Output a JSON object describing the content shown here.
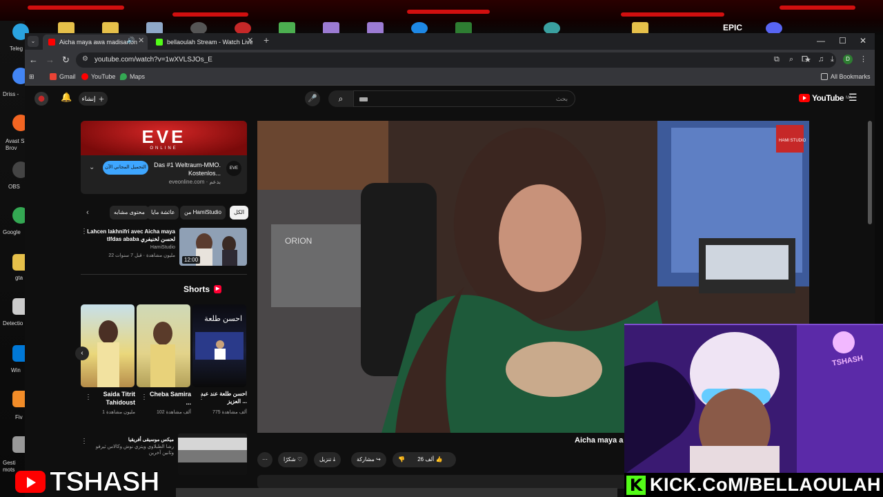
{
  "desktop": {
    "left_icons": [
      {
        "label": "Teleg",
        "color": "#2aa3e0"
      },
      {
        "label": "Driss -",
        "color": "#4285f4"
      },
      {
        "label": "Avast S Brov",
        "color": "#f26522"
      },
      {
        "label": "OBS",
        "color": "#444444"
      },
      {
        "label": "Google",
        "color": "#34a853"
      },
      {
        "label": "gta",
        "color": "#e6c04a"
      },
      {
        "label": "Detectio",
        "color": "#cccccc"
      },
      {
        "label": "Win",
        "color": "#0078d7"
      },
      {
        "label": "Fiv",
        "color": "#f28c28"
      },
      {
        "label": "Gesti mots",
        "color": "#999999"
      }
    ],
    "epic_label": "EPIC"
  },
  "browser": {
    "tabs": [
      {
        "title": "Aicha maya awa madisarton",
        "active": true
      },
      {
        "title": "bellaoulah Stream - Watch Live",
        "active": false
      }
    ],
    "new_tab": "+",
    "window_controls": {
      "minimize": "—",
      "maximize": "☐",
      "close": "✕"
    },
    "url": "youtube.com/watch?v=1wXVLSJOs_E",
    "profile_initial": "D",
    "bookmarks": [
      {
        "label": "Gmail",
        "color": "#ea4335"
      },
      {
        "label": "YouTube",
        "color": "#ff0000"
      },
      {
        "label": "Maps",
        "color": "#34a853"
      }
    ],
    "all_bookmarks": "All Bookmarks"
  },
  "youtube": {
    "create_label": "إنشاء",
    "search_placeholder": "بحث",
    "logo_text": "YouTube",
    "logo_country": "MA",
    "ad": {
      "brand": "EVE",
      "brand_sub": "ONLINE",
      "title": "Das #1 Weltraum-MMO. Kostenlos...",
      "sponsor": "eveonline.com · بدعم",
      "cta": "التحميل المجاني الآن",
      "logo": "EVE"
    },
    "chips": [
      "الكل",
      "من HamiStudio",
      "عائشة مايا",
      "محتوى مشابه"
    ],
    "recommended": {
      "title": "Lahcen lakhnifri avec Aicha maya tlfdas ababa لحسن لخنيفري",
      "channel": "HamiStudio",
      "meta": "22 مليون مشاهدة · قبل 7 سنوات",
      "duration": "12:00"
    },
    "shorts_heading": "Shorts",
    "shorts": [
      {
        "title": "Saida Titrit Tahidoust",
        "views": "1 مليون مشاهدة"
      },
      {
        "title": "Cheba Samira ...",
        "views": "102 ألف مشاهدة"
      },
      {
        "title": "احسن طلعة عند عبد العزيز ...",
        "views": "775 ألف مشاهدة",
        "overlay": "احسن طلعة"
      }
    ],
    "recommended2": {
      "title": "ميكس موسيقى أفريقيا",
      "channel": "رشا الطبلاوي ويتزي نوش وكالاس ثيرفو وثانين آخرين"
    },
    "player": {
      "logo_text": "HAMI STUDIO",
      "mixer_brand": "ORION"
    },
    "video_title": "Aicha maya a",
    "actions": {
      "like": "26 ألف",
      "share": "مشاركة",
      "download": "تنزيل",
      "thanks": "شكرًا",
      "more": "···"
    }
  },
  "overlays": {
    "cam_tag": "TSHASH",
    "kick_url": "KICK.CoM/BELLAOULAH",
    "youtube_handle": "TSHASH"
  }
}
